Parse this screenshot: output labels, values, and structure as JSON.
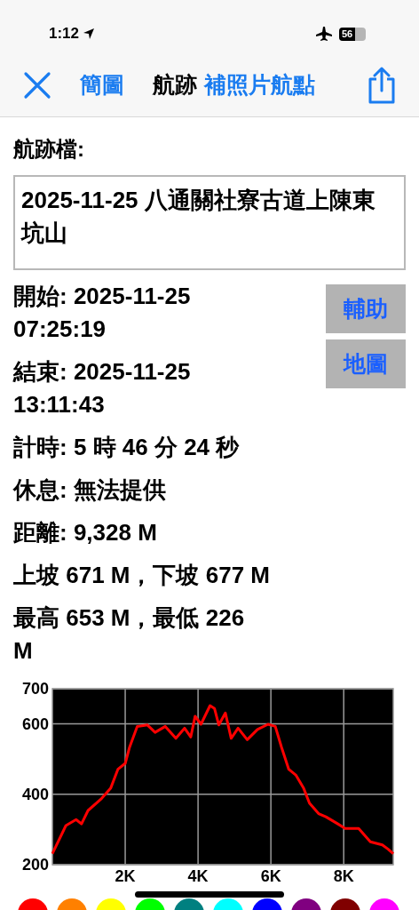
{
  "status_bar": {
    "time": "1:12",
    "battery": "56"
  },
  "nav": {
    "tabs": [
      {
        "label": "簡圖",
        "selected": false
      },
      {
        "label": "航跡",
        "selected": true
      },
      {
        "label": "補照片航點",
        "selected": false
      }
    ]
  },
  "track_file": {
    "label": "航跡檔:",
    "value": "2025-11-25 八通關社寮古道上陳東坑山"
  },
  "side_buttons": [
    "輔助",
    "地圖"
  ],
  "stats": [
    {
      "text": "開始: 2025-11-25\n07:25:19"
    },
    {
      "text": "結束: 2025-11-25\n13:11:43"
    },
    {
      "text": "計時: 5 時 46 分 24 秒"
    },
    {
      "text": "休息: 無法提供"
    },
    {
      "text": "距離: 9,328 M"
    },
    {
      "text": "上坡 671 M，下坡 677 M"
    },
    {
      "text": "最高 653 M，最低 226\nM"
    }
  ],
  "chart_data": {
    "type": "line",
    "grid": true,
    "xlim": [
      0,
      9360
    ],
    "ylim": [
      200,
      700
    ],
    "xticks": [
      {
        "value": 2000,
        "label": "2K"
      },
      {
        "value": 4000,
        "label": "4K"
      },
      {
        "value": 6000,
        "label": "6K"
      },
      {
        "value": 8000,
        "label": "8K"
      }
    ],
    "yticks": [
      200,
      400,
      600,
      700
    ],
    "x": [
      0,
      370,
      650,
      800,
      980,
      1350,
      1600,
      1800,
      2000,
      2120,
      2330,
      2610,
      2820,
      3100,
      3390,
      3630,
      3800,
      3920,
      4080,
      4330,
      4450,
      4570,
      4750,
      4910,
      5100,
      5350,
      5630,
      5920,
      6120,
      6290,
      6490,
      6690,
      6900,
      7060,
      7310,
      7510,
      7840,
      8040,
      8410,
      8730,
      9060,
      9220,
      9360
    ],
    "series": [
      {
        "color": "#ff0000",
        "values": [
          231,
          311,
          328,
          316,
          354,
          388,
          417,
          471,
          488,
          534,
          593,
          597,
          576,
          593,
          559,
          588,
          563,
          622,
          599,
          652,
          644,
          597,
          631,
          559,
          588,
          555,
          584,
          599,
          593,
          534,
          471,
          454,
          417,
          375,
          345,
          336,
          316,
          303,
          303,
          265,
          256,
          244,
          231
        ]
      }
    ]
  },
  "color_swatches": [
    {
      "color": "#ff0000"
    },
    {
      "color": "#ff8000"
    },
    {
      "color": "#ffff00"
    },
    {
      "color": "#00ff00"
    },
    {
      "color": "#008080"
    },
    {
      "color": "#00ffff"
    },
    {
      "color": "#0000ff"
    },
    {
      "color": "#800080"
    },
    {
      "color": "#800000"
    },
    {
      "color": "#ff00ff"
    }
  ]
}
